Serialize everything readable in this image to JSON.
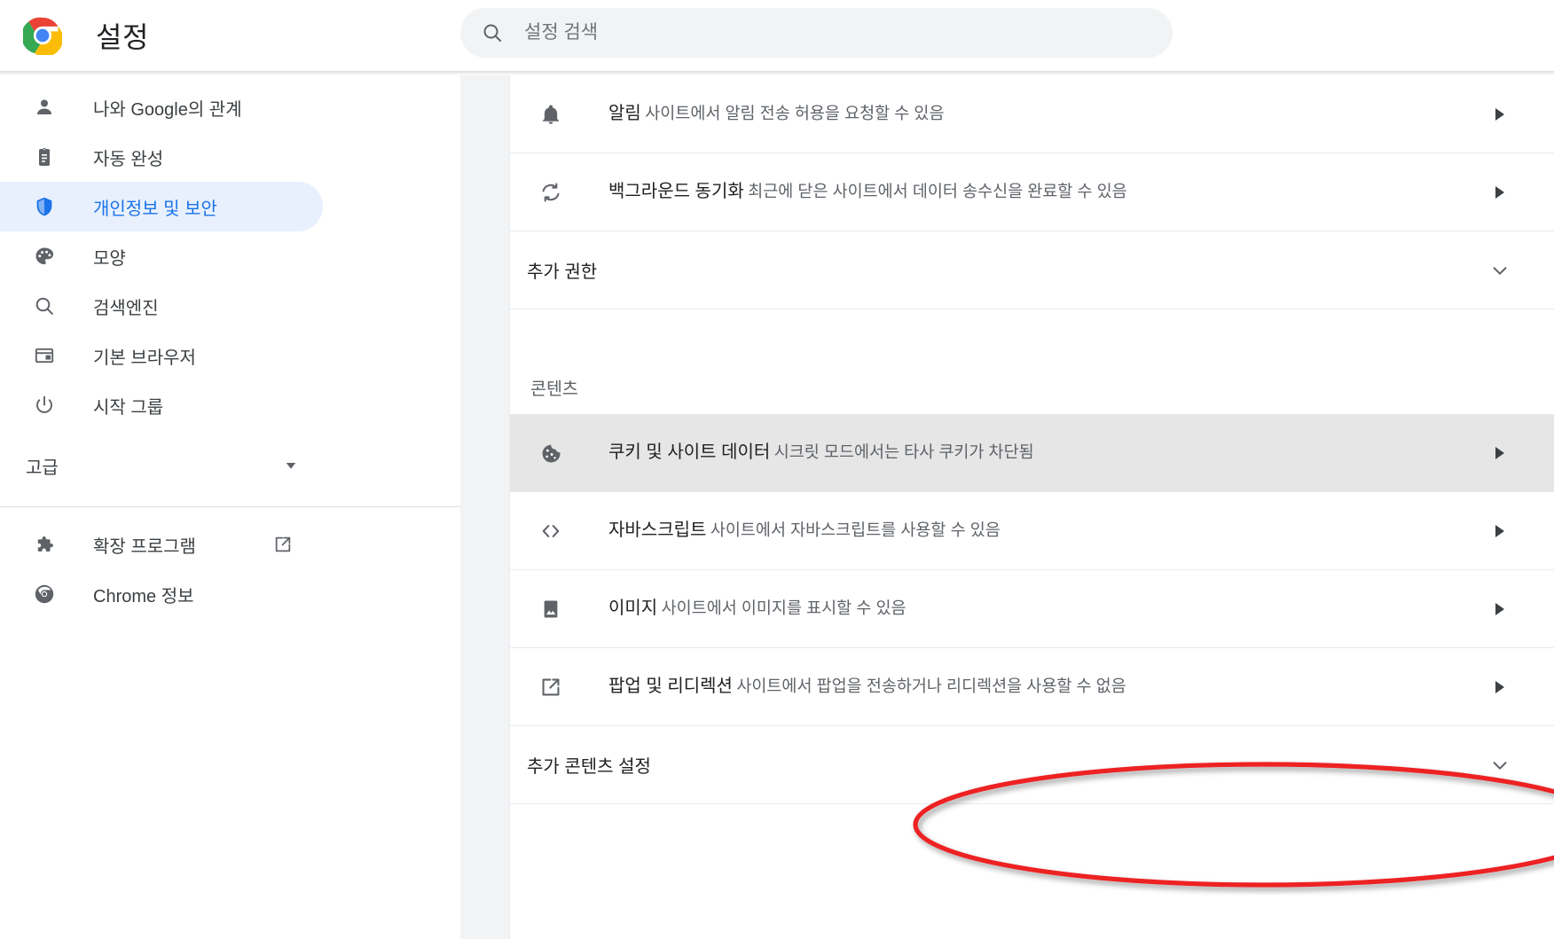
{
  "app": {
    "title": "설정",
    "logo_icon": "chrome-logo-icon"
  },
  "search": {
    "placeholder": "설정 검색",
    "value": "",
    "icon": "search-icon"
  },
  "sidebar": {
    "items": [
      {
        "label": "나와 Google의 관계",
        "icon": "person-icon",
        "selected": false
      },
      {
        "label": "자동 완성",
        "icon": "clipboard-icon",
        "selected": false
      },
      {
        "label": "개인정보 및 보안",
        "icon": "shield-icon",
        "selected": true
      },
      {
        "label": "모양",
        "icon": "palette-icon",
        "selected": false
      },
      {
        "label": "검색엔진",
        "icon": "search-icon",
        "selected": false
      },
      {
        "label": "기본 브라우저",
        "icon": "browser-window-icon",
        "selected": false
      },
      {
        "label": "시작 그룹",
        "icon": "power-icon",
        "selected": false
      }
    ],
    "advanced": {
      "label": "고급",
      "icon": "caret-down-icon"
    },
    "footer_items": [
      {
        "label": "확장 프로그램",
        "icon": "puzzle-icon",
        "trailing_icon": "external-link-icon"
      },
      {
        "label": "Chrome 정보",
        "icon": "chrome-mono-icon",
        "trailing_icon": ""
      }
    ]
  },
  "content": {
    "permission_rows": [
      {
        "title": "알림",
        "subtitle": "사이트에서 알림 전송 허용을 요청할 수 있음",
        "icon": "bell-icon",
        "arrow": "arrow-right-icon",
        "highlighted": false
      },
      {
        "title": "백그라운드 동기화",
        "subtitle": "최근에 닫은 사이트에서 데이터 송수신을 완료할 수 있음",
        "icon": "sync-icon",
        "arrow": "arrow-right-icon",
        "highlighted": false
      }
    ],
    "additional_permissions": {
      "label": "추가 권한",
      "caret": "chevron-down-icon"
    },
    "content_group_label": "콘텐츠",
    "content_rows": [
      {
        "title": "쿠키 및 사이트 데이터",
        "subtitle": "시크릿 모드에서는 타사 쿠키가 차단됨",
        "icon": "cookie-icon",
        "arrow": "arrow-right-icon",
        "highlighted": true
      },
      {
        "title": "자바스크립트",
        "subtitle": "사이트에서 자바스크립트를 사용할 수 있음",
        "icon": "code-icon",
        "arrow": "arrow-right-icon",
        "highlighted": false
      },
      {
        "title": "이미지",
        "subtitle": "사이트에서 이미지를 표시할 수 있음",
        "icon": "image-icon",
        "arrow": "arrow-right-icon",
        "highlighted": false
      },
      {
        "title": "팝업 및 리디렉션",
        "subtitle": "사이트에서 팝업을 전송하거나 리디렉션을 사용할 수 없음",
        "icon": "external-link-icon",
        "arrow": "arrow-right-icon",
        "highlighted": false
      }
    ],
    "additional_content_settings": {
      "label": "추가 콘텐츠 설정",
      "caret": "chevron-down-icon"
    }
  },
  "annotation": {
    "shape": "red-ellipse-highlight",
    "color": "#ed2024",
    "targets": "팝업 및 리디렉션"
  },
  "colors": {
    "accent": "#1a73e8",
    "selected_nav_bg": "#e8f0fe",
    "row_highlight_bg": "#e6e6e6",
    "page_bg": "#f1f3f4",
    "annotation_red": "#ed2024"
  }
}
